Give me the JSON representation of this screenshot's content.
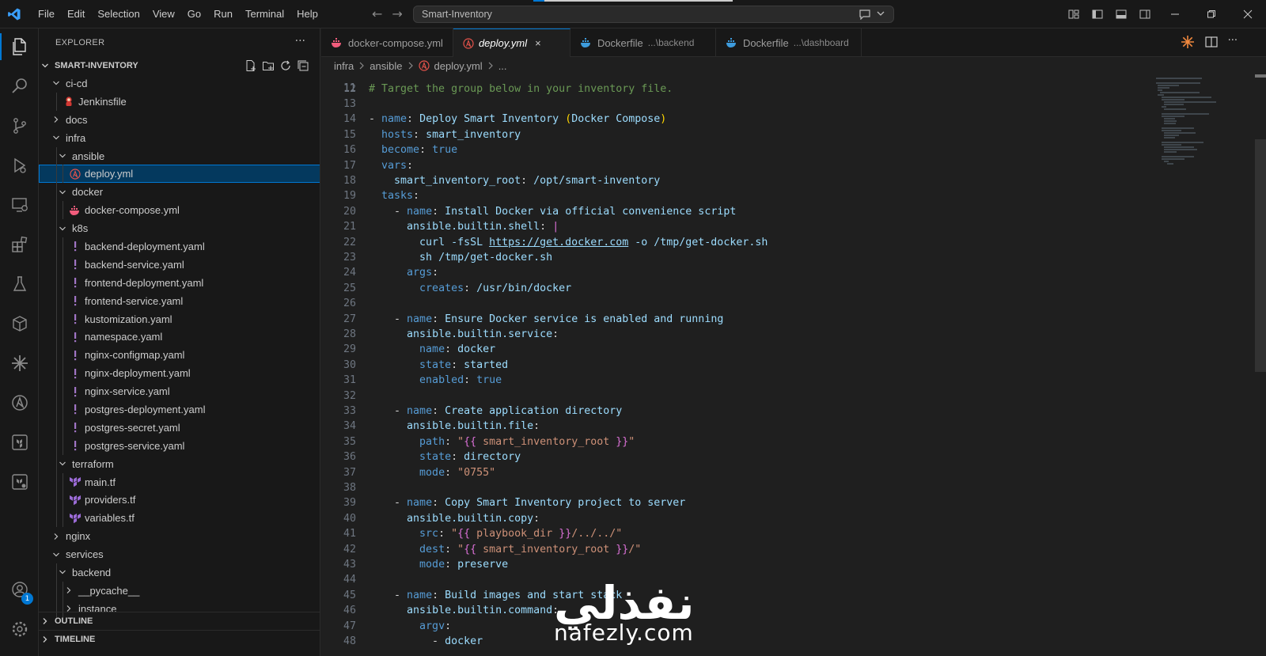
{
  "window": {
    "menu": [
      "File",
      "Edit",
      "Selection",
      "View",
      "Go",
      "Run",
      "Terminal",
      "Help"
    ],
    "command_center": "Smart-Inventory",
    "colors": {
      "accent": "#0078d4",
      "background": "#1f1f1f",
      "sidebar": "#181818"
    }
  },
  "activity": {
    "icons": [
      "explorer-icon",
      "search-icon",
      "source-control-icon",
      "run-debug-icon",
      "remote-explorer-icon",
      "extensions-icon",
      "testing-icon",
      "containers-icon",
      "copilot-icon",
      "ansible-icon",
      "terraform-icon",
      "terraform-cloud-icon",
      "accounts-icon",
      "settings-icon"
    ],
    "accounts_badge": "1"
  },
  "sidebar": {
    "title": "EXPLORER",
    "more": "···",
    "root": "SMART-INVENTORY",
    "outline": "OUTLINE",
    "timeline": "TIMELINE",
    "tree": [
      {
        "label": "ci-cd",
        "type": "folder",
        "open": true,
        "depth": 1
      },
      {
        "label": "Jenkinsfile",
        "type": "jenkins",
        "depth": 2
      },
      {
        "label": "docs",
        "type": "folder",
        "open": false,
        "depth": 1
      },
      {
        "label": "infra",
        "type": "folder",
        "open": true,
        "depth": 1
      },
      {
        "label": "ansible",
        "type": "folder",
        "open": true,
        "depth": 2
      },
      {
        "label": "deploy.yml",
        "type": "ansible",
        "depth": 3,
        "selected": true
      },
      {
        "label": "docker",
        "type": "folder",
        "open": true,
        "depth": 2
      },
      {
        "label": "docker-compose.yml",
        "type": "docker-compose",
        "depth": 3
      },
      {
        "label": "k8s",
        "type": "folder",
        "open": true,
        "depth": 2
      },
      {
        "label": "backend-deployment.yaml",
        "type": "yaml",
        "depth": 3
      },
      {
        "label": "backend-service.yaml",
        "type": "yaml",
        "depth": 3
      },
      {
        "label": "frontend-deployment.yaml",
        "type": "yaml",
        "depth": 3
      },
      {
        "label": "frontend-service.yaml",
        "type": "yaml",
        "depth": 3
      },
      {
        "label": "kustomization.yaml",
        "type": "yaml",
        "depth": 3
      },
      {
        "label": "namespace.yaml",
        "type": "yaml",
        "depth": 3
      },
      {
        "label": "nginx-configmap.yaml",
        "type": "yaml",
        "depth": 3
      },
      {
        "label": "nginx-deployment.yaml",
        "type": "yaml",
        "depth": 3
      },
      {
        "label": "nginx-service.yaml",
        "type": "yaml",
        "depth": 3
      },
      {
        "label": "postgres-deployment.yaml",
        "type": "yaml",
        "depth": 3
      },
      {
        "label": "postgres-secret.yaml",
        "type": "yaml",
        "depth": 3
      },
      {
        "label": "postgres-service.yaml",
        "type": "yaml",
        "depth": 3
      },
      {
        "label": "terraform",
        "type": "folder",
        "open": true,
        "depth": 2
      },
      {
        "label": "main.tf",
        "type": "terraform",
        "depth": 3
      },
      {
        "label": "providers.tf",
        "type": "terraform",
        "depth": 3
      },
      {
        "label": "variables.tf",
        "type": "terraform",
        "depth": 3
      },
      {
        "label": "nginx",
        "type": "folder",
        "open": false,
        "depth": 1
      },
      {
        "label": "services",
        "type": "folder",
        "open": true,
        "depth": 1
      },
      {
        "label": "backend",
        "type": "folder",
        "open": true,
        "depth": 2
      },
      {
        "label": "__pycache__",
        "type": "folder",
        "open": false,
        "depth": 3
      },
      {
        "label": "instance",
        "type": "folder",
        "open": false,
        "depth": 3
      }
    ]
  },
  "tabs": [
    {
      "label": "docker-compose.yml",
      "desc": "",
      "icon": "docker-compose",
      "active": false
    },
    {
      "label": "deploy.yml",
      "desc": "",
      "icon": "ansible",
      "active": true,
      "close": "×"
    },
    {
      "label": "Dockerfile",
      "desc": "...\\backend",
      "icon": "docker",
      "active": false
    },
    {
      "label": "Dockerfile",
      "desc": "...\\dashboard",
      "icon": "docker",
      "active": false
    }
  ],
  "breadcrumb": [
    "infra",
    "ansible",
    "deploy.yml",
    "..."
  ],
  "code": [
    {
      "n": "12",
      "t": [
        [
          "c",
          "# Target the group below in your inventory file."
        ]
      ]
    },
    {
      "n": "13",
      "t": []
    },
    {
      "n": "14",
      "t": [
        [
          "d",
          "- "
        ],
        [
          "k",
          "name"
        ],
        [
          "d",
          ": "
        ],
        [
          "tk",
          "Deploy Smart Inventory "
        ],
        [
          "paren",
          "("
        ],
        [
          "tk",
          "Docker Compose"
        ],
        [
          "paren",
          ")"
        ]
      ]
    },
    {
      "n": "15",
      "t": [
        [
          "d",
          "  "
        ],
        [
          "k",
          "hosts"
        ],
        [
          "d",
          ": "
        ],
        [
          "tk",
          "smart_inventory"
        ]
      ]
    },
    {
      "n": "16",
      "t": [
        [
          "d",
          "  "
        ],
        [
          "k",
          "become"
        ],
        [
          "d",
          ": "
        ],
        [
          "b",
          "true"
        ]
      ]
    },
    {
      "n": "17",
      "t": [
        [
          "d",
          "  "
        ],
        [
          "k",
          "vars"
        ],
        [
          "d",
          ":"
        ]
      ]
    },
    {
      "n": "18",
      "t": [
        [
          "d",
          "    "
        ],
        [
          "tk",
          "smart_inventory_root"
        ],
        [
          "d",
          ": "
        ],
        [
          "tk",
          "/opt/smart-inventory"
        ]
      ]
    },
    {
      "n": "19",
      "t": [
        [
          "d",
          "  "
        ],
        [
          "k",
          "tasks"
        ],
        [
          "d",
          ":"
        ]
      ]
    },
    {
      "n": "20",
      "t": [
        [
          "d",
          "    - "
        ],
        [
          "k",
          "name"
        ],
        [
          "d",
          ": "
        ],
        [
          "tk",
          "Install Docker via official convenience script"
        ]
      ]
    },
    {
      "n": "21",
      "t": [
        [
          "d",
          "      "
        ],
        [
          "tk",
          "ansible.builtin.shell"
        ],
        [
          "d",
          ": "
        ],
        [
          "brace",
          "|"
        ]
      ]
    },
    {
      "n": "22",
      "t": [
        [
          "d",
          "        "
        ],
        [
          "tk",
          "curl -fsSL "
        ],
        [
          "link",
          "https://get.docker.com"
        ],
        [
          "tk",
          " -o /tmp/get-docker.sh"
        ]
      ]
    },
    {
      "n": "23",
      "t": [
        [
          "d",
          "        "
        ],
        [
          "tk",
          "sh /tmp/get-docker.sh"
        ]
      ]
    },
    {
      "n": "24",
      "t": [
        [
          "d",
          "      "
        ],
        [
          "k",
          "args"
        ],
        [
          "d",
          ":"
        ]
      ]
    },
    {
      "n": "25",
      "t": [
        [
          "d",
          "        "
        ],
        [
          "k",
          "creates"
        ],
        [
          "d",
          ": "
        ],
        [
          "tk",
          "/usr/bin/docker"
        ]
      ]
    },
    {
      "n": "26",
      "t": []
    },
    {
      "n": "27",
      "t": [
        [
          "d",
          "    - "
        ],
        [
          "k",
          "name"
        ],
        [
          "d",
          ": "
        ],
        [
          "tk",
          "Ensure Docker service is enabled and running"
        ]
      ]
    },
    {
      "n": "28",
      "t": [
        [
          "d",
          "      "
        ],
        [
          "tk",
          "ansible.builtin.service"
        ],
        [
          "d",
          ":"
        ]
      ]
    },
    {
      "n": "29",
      "t": [
        [
          "d",
          "        "
        ],
        [
          "k",
          "name"
        ],
        [
          "d",
          ": "
        ],
        [
          "tk",
          "docker"
        ]
      ]
    },
    {
      "n": "30",
      "t": [
        [
          "d",
          "        "
        ],
        [
          "k",
          "state"
        ],
        [
          "d",
          ": "
        ],
        [
          "tk",
          "started"
        ]
      ]
    },
    {
      "n": "31",
      "t": [
        [
          "d",
          "        "
        ],
        [
          "k",
          "enabled"
        ],
        [
          "d",
          ": "
        ],
        [
          "b",
          "true"
        ]
      ]
    },
    {
      "n": "32",
      "t": []
    },
    {
      "n": "33",
      "t": [
        [
          "d",
          "    - "
        ],
        [
          "k",
          "name"
        ],
        [
          "d",
          ": "
        ],
        [
          "tk",
          "Create application directory"
        ]
      ]
    },
    {
      "n": "34",
      "t": [
        [
          "d",
          "      "
        ],
        [
          "tk",
          "ansible.builtin.file"
        ],
        [
          "d",
          ":"
        ]
      ]
    },
    {
      "n": "35",
      "t": [
        [
          "d",
          "        "
        ],
        [
          "k",
          "path"
        ],
        [
          "d",
          ": "
        ],
        [
          "v",
          "\""
        ],
        [
          "brace",
          "{{"
        ],
        [
          "v",
          " smart_inventory_root "
        ],
        [
          "brace",
          "}}"
        ],
        [
          "v",
          "\""
        ]
      ]
    },
    {
      "n": "36",
      "t": [
        [
          "d",
          "        "
        ],
        [
          "k",
          "state"
        ],
        [
          "d",
          ": "
        ],
        [
          "tk",
          "directory"
        ]
      ]
    },
    {
      "n": "37",
      "t": [
        [
          "d",
          "        "
        ],
        [
          "k",
          "mode"
        ],
        [
          "d",
          ": "
        ],
        [
          "v",
          "\"0755\""
        ]
      ]
    },
    {
      "n": "38",
      "t": []
    },
    {
      "n": "39",
      "t": [
        [
          "d",
          "    - "
        ],
        [
          "k",
          "name"
        ],
        [
          "d",
          ": "
        ],
        [
          "tk",
          "Copy Smart Inventory project to server"
        ]
      ]
    },
    {
      "n": "40",
      "t": [
        [
          "d",
          "      "
        ],
        [
          "tk",
          "ansible.builtin.copy"
        ],
        [
          "d",
          ":"
        ]
      ]
    },
    {
      "n": "41",
      "t": [
        [
          "d",
          "        "
        ],
        [
          "k",
          "src"
        ],
        [
          "d",
          ": "
        ],
        [
          "v",
          "\""
        ],
        [
          "brace",
          "{{"
        ],
        [
          "v",
          " playbook_dir "
        ],
        [
          "brace",
          "}}"
        ],
        [
          "v",
          "/../../\""
        ]
      ]
    },
    {
      "n": "42",
      "t": [
        [
          "d",
          "        "
        ],
        [
          "k",
          "dest"
        ],
        [
          "d",
          ": "
        ],
        [
          "v",
          "\""
        ],
        [
          "brace",
          "{{"
        ],
        [
          "v",
          " smart_inventory_root "
        ],
        [
          "brace",
          "}}"
        ],
        [
          "v",
          "/\""
        ]
      ]
    },
    {
      "n": "43",
      "t": [
        [
          "d",
          "        "
        ],
        [
          "k",
          "mode"
        ],
        [
          "d",
          ": "
        ],
        [
          "tk",
          "preserve"
        ]
      ]
    },
    {
      "n": "44",
      "t": []
    },
    {
      "n": "45",
      "t": [
        [
          "d",
          "    - "
        ],
        [
          "k",
          "name"
        ],
        [
          "d",
          ": "
        ],
        [
          "tk",
          "Build images and start stack"
        ]
      ]
    },
    {
      "n": "46",
      "t": [
        [
          "d",
          "      "
        ],
        [
          "tk",
          "ansible.builtin.command"
        ],
        [
          "d",
          ":"
        ]
      ]
    },
    {
      "n": "47",
      "t": [
        [
          "d",
          "        "
        ],
        [
          "k",
          "argv"
        ],
        [
          "d",
          ":"
        ]
      ]
    },
    {
      "n": "48",
      "t": [
        [
          "d",
          "          - "
        ],
        [
          "tk",
          "docker"
        ]
      ]
    }
  ],
  "watermark": {
    "arabic": "نفذلي",
    "latin": "nafezly.com"
  }
}
